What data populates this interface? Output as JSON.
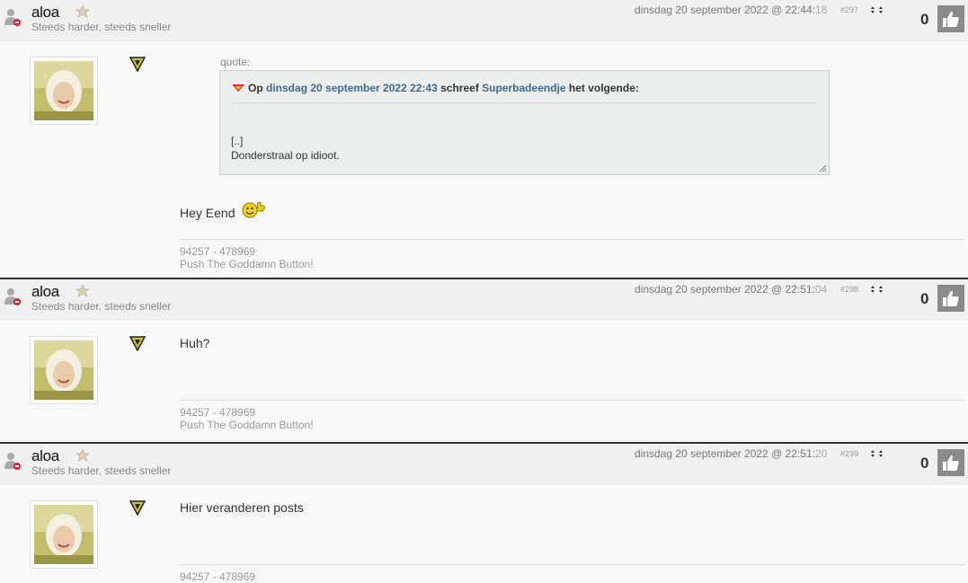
{
  "colors": {
    "header_bg": "#f0f0f0",
    "page_bg": "#f9f9f9",
    "link": "#3e6a8f",
    "like_button_bg": "#8a8a8a",
    "separator": "#333333"
  },
  "posts": [
    {
      "username": "aloa",
      "user_title": "Steeds harder, steeds sneller",
      "date_main": "dinsdag 20 september 2022 @ 22:44:",
      "date_seconds": "18",
      "post_number": "#297",
      "likes": "0",
      "quote": {
        "label": "quote:",
        "op": "Op",
        "date": "dinsdag 20 september 2022 22:43",
        "wrote": "schreef",
        "author": "Superbadeendje",
        "suffix": "het volgende:",
        "line1": "[..]",
        "line2": "Donderstraal op idioot."
      },
      "message": "Hey Eend",
      "signature_line1": "94257 - 478969",
      "signature_line2": "Push The Goddamn Button!"
    },
    {
      "username": "aloa",
      "user_title": "Steeds harder, steeds sneller",
      "date_main": "dinsdag 20 september 2022 @ 22:51:",
      "date_seconds": "04",
      "post_number": "#298",
      "likes": "0",
      "message": "Huh?",
      "signature_line1": "94257 - 478969",
      "signature_line2": "Push The Goddamn Button!"
    },
    {
      "username": "aloa",
      "user_title": "Steeds harder, steeds sneller",
      "date_main": "dinsdag 20 september 2022 @ 22:51:",
      "date_seconds": "20",
      "post_number": "#299",
      "likes": "0",
      "message": "Hier veranderen posts",
      "signature_line1": "94257 - 478969"
    }
  ]
}
